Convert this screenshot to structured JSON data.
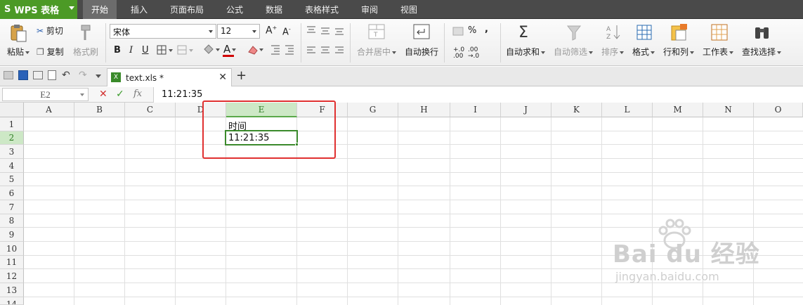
{
  "app": {
    "title": "WPS 表格",
    "logo": "S"
  },
  "menu": {
    "tabs": [
      {
        "label": "开始",
        "active": true
      },
      {
        "label": "插入",
        "active": false
      },
      {
        "label": "页面布局",
        "active": false
      },
      {
        "label": "公式",
        "active": false
      },
      {
        "label": "数据",
        "active": false
      },
      {
        "label": "表格样式",
        "active": false
      },
      {
        "label": "审阅",
        "active": false
      },
      {
        "label": "视图",
        "active": false
      }
    ]
  },
  "ribbon": {
    "paste": "粘贴",
    "cut": "剪切",
    "copy": "复制",
    "format_painter": "格式刷",
    "font_name": "宋体",
    "font_size": "12",
    "bold": "B",
    "italic": "I",
    "underline": "U",
    "merge_center": "合并居中",
    "wrap_text": "自动换行",
    "percent": "%",
    "comma": "،",
    "auto_sum": "自动求和",
    "auto_filter": "自动筛选",
    "sort": "排序",
    "format": "格式",
    "row_col": "行和列",
    "worksheet": "工作表",
    "find_select": "查找选择",
    "font_color_accent": "#d00000"
  },
  "document": {
    "tab_label": "text.xls *"
  },
  "formula_bar": {
    "cell_ref": "E2",
    "fx": "fx",
    "value": "11:21:35"
  },
  "sheet": {
    "columns": [
      "A",
      "B",
      "C",
      "D",
      "E",
      "F",
      "G",
      "H",
      "I",
      "J",
      "K",
      "L",
      "M",
      "N",
      "O"
    ],
    "rows": [
      "1",
      "2",
      "3",
      "4",
      "5",
      "6",
      "7",
      "8",
      "9",
      "10",
      "11",
      "12",
      "13",
      "14"
    ],
    "selected_col": "E",
    "selected_row": "2",
    "cells": {
      "E1": "时间",
      "E2": "11:21:35"
    }
  },
  "watermark": {
    "brand": "Bai du 经验",
    "url": "jingyan.baidu.com"
  }
}
